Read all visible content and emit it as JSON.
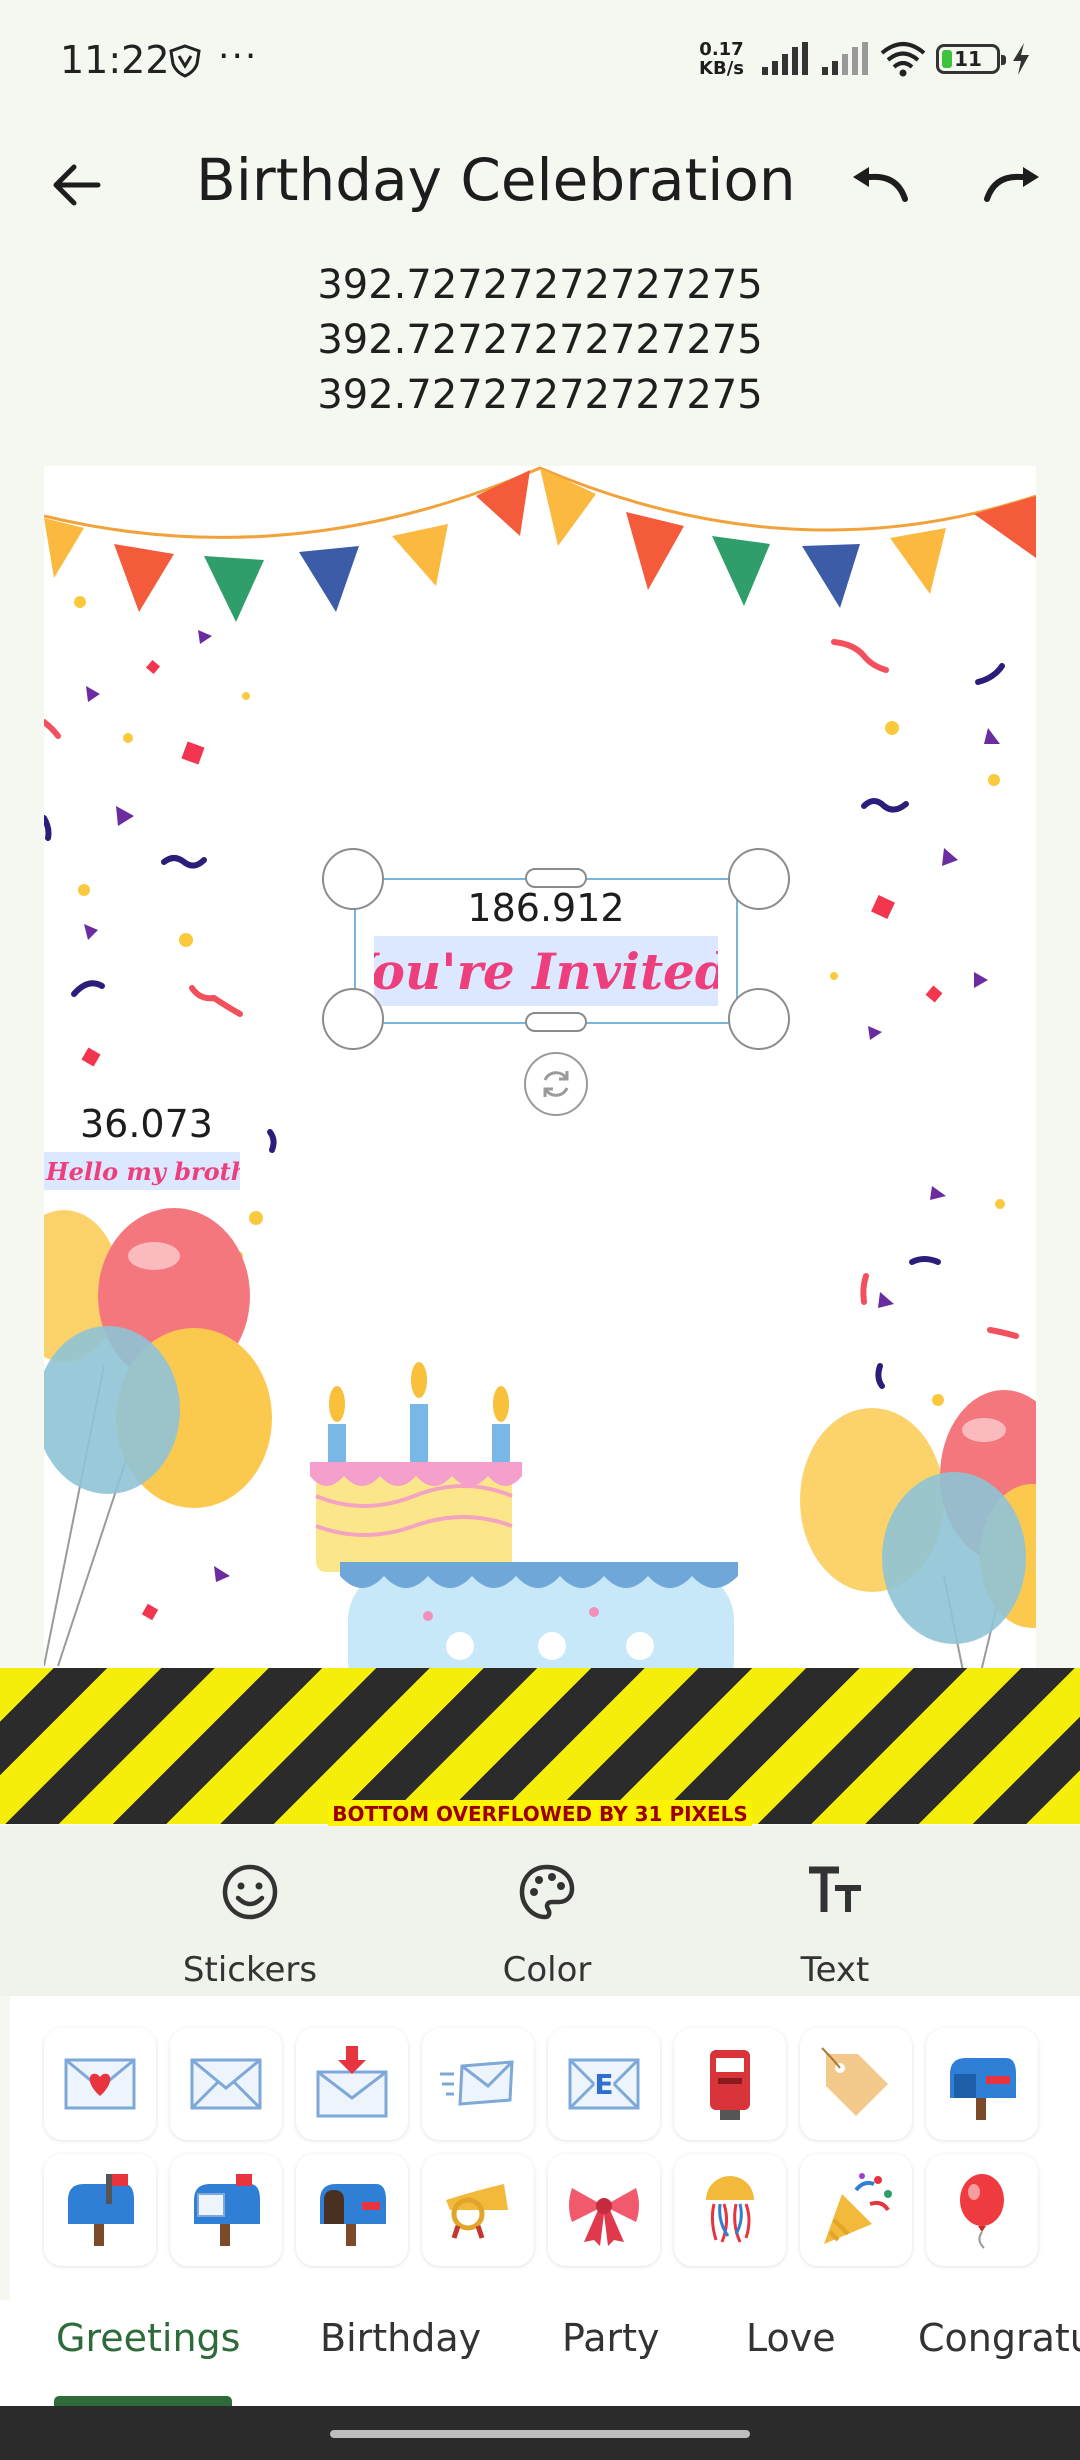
{
  "status": {
    "time": "11:22",
    "dots": "···",
    "speed_value": "0.17",
    "speed_unit": "KB/s",
    "battery": "11"
  },
  "header": {
    "title": "Birthday Celebration"
  },
  "debug": {
    "lines": [
      "392.72727272727275",
      "392.72727272727275",
      "392.72727272727275"
    ]
  },
  "canvas": {
    "selected_text": {
      "size_label": "186.912",
      "content": "You're Invited!",
      "color": "#ee3f7d"
    },
    "second_text": {
      "size_label": "36.073",
      "content": "Hello my brother",
      "color": "#ee3f7d"
    }
  },
  "overflow_warning": "BOTTOM OVERFLOWED BY 31 PIXELS",
  "tools": [
    {
      "label": "Stickers",
      "icon": "smiley-icon"
    },
    {
      "label": "Color",
      "icon": "palette-icon"
    },
    {
      "label": "Text",
      "icon": "text-size-icon"
    }
  ],
  "stickers": [
    {
      "name": "love-letter"
    },
    {
      "name": "envelope"
    },
    {
      "name": "incoming-envelope"
    },
    {
      "name": "flying-envelope"
    },
    {
      "name": "email-envelope"
    },
    {
      "name": "postbox"
    },
    {
      "name": "tag-label"
    },
    {
      "name": "mailbox-closed-flag"
    },
    {
      "name": "mailbox-raised-flag"
    },
    {
      "name": "mailbox-with-mail"
    },
    {
      "name": "mailbox-no-mail"
    },
    {
      "name": "postal-horn"
    },
    {
      "name": "ribbon"
    },
    {
      "name": "confetti-ball"
    },
    {
      "name": "party-popper"
    },
    {
      "name": "balloon"
    }
  ],
  "categories": [
    "Greetings",
    "Birthday",
    "Party",
    "Love",
    "Congratu"
  ],
  "active_category": "Greetings",
  "colors": {
    "accent_green": "#2f6a3b",
    "text_pink": "#ee3f7d",
    "selection_blue": "#dce8ff"
  }
}
